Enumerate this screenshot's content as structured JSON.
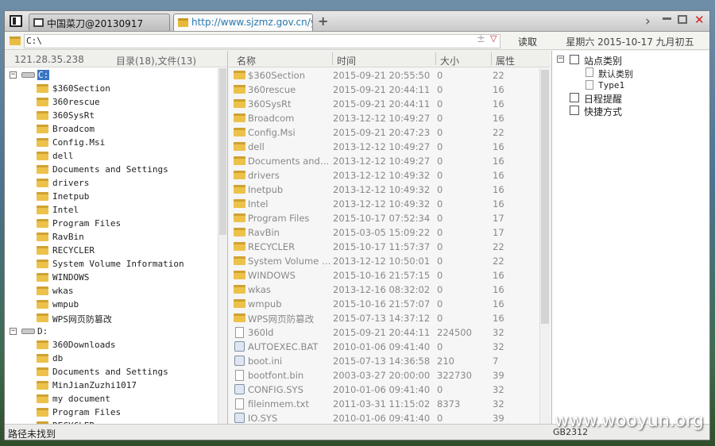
{
  "tabs": [
    {
      "label": "中国菜刀@20130917"
    },
    {
      "label": "http://www.sjzmz.gov.cn/yell..."
    }
  ],
  "address": {
    "value": "C:\\",
    "read_label": "读取",
    "date": "星期六 2015-10-17 九月初五"
  },
  "left_panel": {
    "ip": "121.28.35.238",
    "counts": "目录(18),文件(13)",
    "tree": [
      {
        "label": "C:",
        "type": "drive",
        "expanded": "−",
        "selected": true
      },
      {
        "label": "$360Section"
      },
      {
        "label": "360rescue"
      },
      {
        "label": "360SysRt"
      },
      {
        "label": "Broadcom"
      },
      {
        "label": "Config.Msi"
      },
      {
        "label": "dell"
      },
      {
        "label": "Documents and Settings"
      },
      {
        "label": "drivers"
      },
      {
        "label": "Inetpub"
      },
      {
        "label": "Intel"
      },
      {
        "label": "Program Files"
      },
      {
        "label": "RavBin"
      },
      {
        "label": "RECYCLER"
      },
      {
        "label": "System Volume Information"
      },
      {
        "label": "WINDOWS"
      },
      {
        "label": "wkas"
      },
      {
        "label": "wmpub"
      },
      {
        "label": "WPS网页防篡改"
      },
      {
        "label": "D:",
        "type": "drive",
        "expanded": "−"
      },
      {
        "label": "360Downloads"
      },
      {
        "label": "db"
      },
      {
        "label": "Documents and Settings"
      },
      {
        "label": "MinJianZuzhi1017"
      },
      {
        "label": "my document"
      },
      {
        "label": "Program Files"
      },
      {
        "label": "RECYCLER"
      }
    ]
  },
  "file_list": {
    "columns": {
      "name": "名称",
      "time": "时间",
      "size": "大小",
      "attr": "属性"
    },
    "rows": [
      {
        "name": "$360Section",
        "time": "2015-09-21 20:55:50",
        "size": "0",
        "attr": "22",
        "icon": "folder"
      },
      {
        "name": "360rescue",
        "time": "2015-09-21 20:44:11",
        "size": "0",
        "attr": "16",
        "icon": "folder"
      },
      {
        "name": "360SysRt",
        "time": "2015-09-21 20:44:11",
        "size": "0",
        "attr": "16",
        "icon": "folder"
      },
      {
        "name": "Broadcom",
        "time": "2013-12-12 10:49:27",
        "size": "0",
        "attr": "16",
        "icon": "folder"
      },
      {
        "name": "Config.Msi",
        "time": "2015-09-21 20:47:23",
        "size": "0",
        "attr": "22",
        "icon": "folder"
      },
      {
        "name": "dell",
        "time": "2013-12-12 10:49:27",
        "size": "0",
        "attr": "16",
        "icon": "folder"
      },
      {
        "name": "Documents and Set...",
        "time": "2013-12-12 10:49:27",
        "size": "0",
        "attr": "16",
        "icon": "folder"
      },
      {
        "name": "drivers",
        "time": "2013-12-12 10:49:32",
        "size": "0",
        "attr": "16",
        "icon": "folder"
      },
      {
        "name": "Inetpub",
        "time": "2013-12-12 10:49:32",
        "size": "0",
        "attr": "16",
        "icon": "folder"
      },
      {
        "name": "Intel",
        "time": "2013-12-12 10:49:32",
        "size": "0",
        "attr": "16",
        "icon": "folder"
      },
      {
        "name": "Program Files",
        "time": "2015-10-17 07:52:34",
        "size": "0",
        "attr": "17",
        "icon": "folder"
      },
      {
        "name": "RavBin",
        "time": "2015-03-05 15:09:22",
        "size": "0",
        "attr": "17",
        "icon": "folder"
      },
      {
        "name": "RECYCLER",
        "time": "2015-10-17 11:57:37",
        "size": "0",
        "attr": "22",
        "icon": "folder"
      },
      {
        "name": "System Volume Info...",
        "time": "2013-12-12 10:50:01",
        "size": "0",
        "attr": "22",
        "icon": "folder"
      },
      {
        "name": "WINDOWS",
        "time": "2015-10-16 21:57:15",
        "size": "0",
        "attr": "16",
        "icon": "folder"
      },
      {
        "name": "wkas",
        "time": "2013-12-16 08:32:02",
        "size": "0",
        "attr": "16",
        "icon": "folder"
      },
      {
        "name": "wmpub",
        "time": "2015-10-16 21:57:07",
        "size": "0",
        "attr": "16",
        "icon": "folder"
      },
      {
        "name": "WPS网页防篡改",
        "time": "2015-07-13 14:37:12",
        "size": "0",
        "attr": "16",
        "icon": "folder"
      },
      {
        "name": "360ld",
        "time": "2015-09-21 20:44:11",
        "size": "224500",
        "attr": "32",
        "icon": "file"
      },
      {
        "name": "AUTOEXEC.BAT",
        "time": "2010-01-06 09:41:40",
        "size": "0",
        "attr": "32",
        "icon": "config"
      },
      {
        "name": "boot.ini",
        "time": "2015-07-13 14:36:58",
        "size": "210",
        "attr": "7",
        "icon": "config"
      },
      {
        "name": "bootfont.bin",
        "time": "2003-03-27 20:00:00",
        "size": "322730",
        "attr": "39",
        "icon": "file"
      },
      {
        "name": "CONFIG.SYS",
        "time": "2010-01-06 09:41:40",
        "size": "0",
        "attr": "32",
        "icon": "config"
      },
      {
        "name": "fileinmem.txt",
        "time": "2011-03-31 11:15:02",
        "size": "8373",
        "attr": "32",
        "icon": "file"
      },
      {
        "name": "IO.SYS",
        "time": "2010-01-06 09:41:40",
        "size": "0",
        "attr": "39",
        "icon": "config"
      }
    ]
  },
  "right_panel": {
    "items": [
      {
        "label": "站点类别",
        "level": 0,
        "expander": "−",
        "icon": "box"
      },
      {
        "label": "默认类别",
        "level": 1,
        "icon": "doc"
      },
      {
        "label": "Type1",
        "level": 1,
        "icon": "doc"
      },
      {
        "label": "日程提醒",
        "level": 0,
        "icon": "box"
      },
      {
        "label": "快捷方式",
        "level": 0,
        "icon": "box"
      }
    ]
  },
  "status": {
    "text": "路径未找到",
    "encoding": "GB2312"
  },
  "watermark": "www.wooyun.org"
}
